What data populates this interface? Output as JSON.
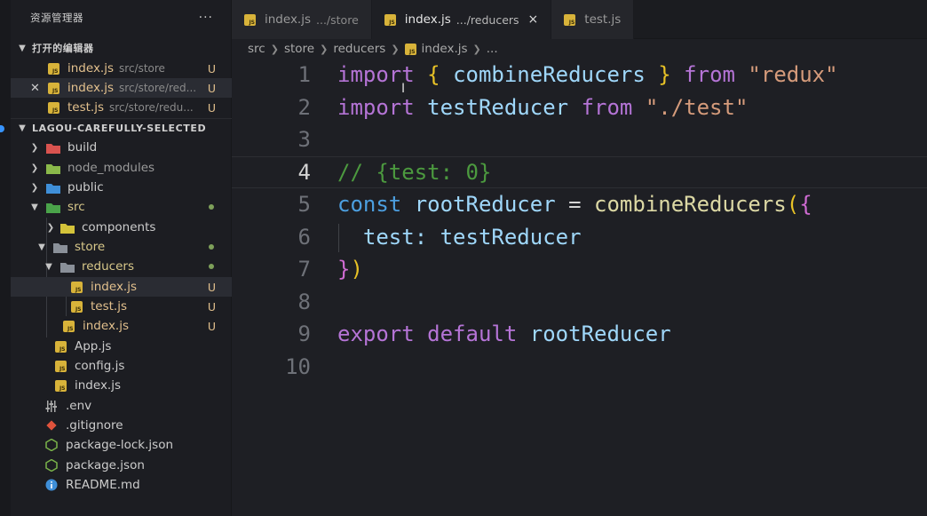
{
  "sidebar": {
    "title": "资源管理器",
    "more": "···",
    "open_editors": {
      "label": "打开的编辑器",
      "items": [
        {
          "name": "index.js",
          "desc": "src/store",
          "status": "U"
        },
        {
          "name": "index.js",
          "desc": "src/store/red...",
          "status": "U"
        },
        {
          "name": "test.js",
          "desc": "src/store/redu...",
          "status": "U"
        }
      ]
    },
    "project": {
      "label": "LAGOU-CAREFULLY-SELECTED",
      "items": [
        {
          "name": "build"
        },
        {
          "name": "node_modules"
        },
        {
          "name": "public"
        },
        {
          "name": "src"
        },
        {
          "name": "components"
        },
        {
          "name": "store"
        },
        {
          "name": "reducers"
        },
        {
          "name": "index.js",
          "status": "U"
        },
        {
          "name": "test.js",
          "status": "U"
        },
        {
          "name": "index.js",
          "status": "U"
        },
        {
          "name": "App.js"
        },
        {
          "name": "config.js"
        },
        {
          "name": "index.js"
        },
        {
          "name": ".env"
        },
        {
          "name": ".gitignore"
        },
        {
          "name": "package-lock.json"
        },
        {
          "name": "package.json"
        },
        {
          "name": "README.md"
        }
      ]
    }
  },
  "tabs": [
    {
      "name": "index.js",
      "desc": ".../store"
    },
    {
      "name": "index.js",
      "desc": ".../reducers",
      "close": "×"
    },
    {
      "name": "test.js",
      "desc": ""
    }
  ],
  "breadcrumb": [
    "src",
    "store",
    "reducers",
    "index.js",
    "..."
  ],
  "icons": {
    "file": "js-icon",
    "folder": "folder-icon",
    "chevron": "chevron-icon",
    "close": "close-icon"
  },
  "colors": {
    "accent": "#3794ff",
    "untracked": "#e2c08d",
    "keyword": "#b574d6",
    "string": "#d59b7b",
    "comment": "#4c9a3f"
  },
  "code": {
    "line_numbers": [
      "1",
      "2",
      "3",
      "4",
      "5",
      "6",
      "7",
      "8",
      "9",
      "10"
    ],
    "l1": {
      "k1": "import",
      "b1": "{",
      "v1": "combineReducers",
      "b2": "}",
      "k2": "from",
      "s1": "\"redux\""
    },
    "l2": {
      "k1": "import",
      "v1": "testReducer",
      "k2": "from",
      "s1": "\"./test\""
    },
    "l4": {
      "c1": "// {test: 0}"
    },
    "l5": {
      "k1": "const",
      "v1": "rootReducer",
      "op": "=",
      "f1": "combineReducers",
      "p1": "(",
      "b1": "{"
    },
    "l6": {
      "v1": "test:",
      "v2": "testReducer"
    },
    "l7": {
      "b1": "}",
      "p1": ")"
    },
    "l9": {
      "k1": "export",
      "k2": "default",
      "v1": "rootReducer"
    }
  }
}
